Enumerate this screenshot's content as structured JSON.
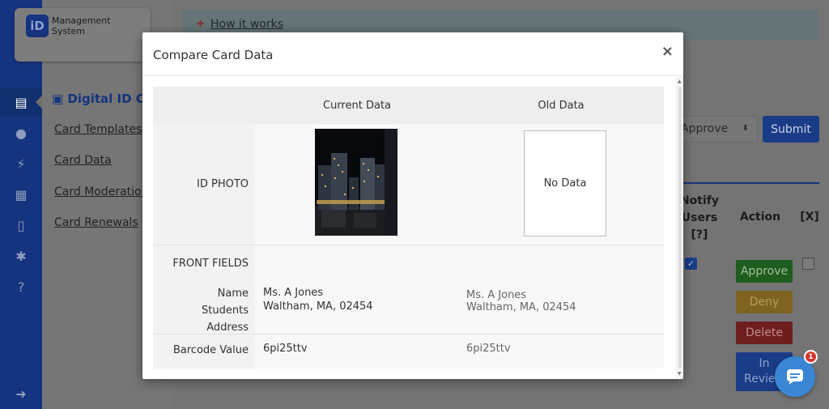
{
  "app": {
    "logo_mark": "iD",
    "logo_line1": "Management",
    "logo_line2": "System"
  },
  "sidebar": {
    "section_title": "Digital ID Car",
    "links": [
      "Card Templates",
      "Card Data",
      "Card Moderation",
      "Card Renewals"
    ]
  },
  "banner": {
    "link": "How it works"
  },
  "toolbar": {
    "select_value": "Approve",
    "submit_label": "Submit"
  },
  "table": {
    "headers": {
      "notify_line1": "Notify",
      "notify_line2": "Users",
      "notify_line3": "[?]",
      "action": "Action",
      "x": "[X]"
    },
    "actions": {
      "approve": "Approve",
      "deny": "Deny",
      "delete": "Delete",
      "in_review_line1": "In",
      "in_review_line2": "Review"
    }
  },
  "modal": {
    "title": "Compare Card Data",
    "close": "×",
    "columns": {
      "current": "Current Data",
      "old": "Old Data"
    },
    "rows": {
      "id_photo": "ID PHOTO",
      "front_fields": "FRONT FIELDS",
      "name_label": "Name",
      "address_label_line1": "Students",
      "address_label_line2": "Address",
      "barcode_label": "Barcode Value"
    },
    "current": {
      "name": "Ms. A Jones",
      "address": "Waltham, MA, 02454",
      "barcode": "6pi25ttv"
    },
    "old": {
      "photo": "No Data",
      "name": "Ms. A Jones",
      "address": "Waltham, MA, 02454",
      "barcode": "6pi25ttv"
    }
  },
  "chat": {
    "badge_count": "1"
  }
}
